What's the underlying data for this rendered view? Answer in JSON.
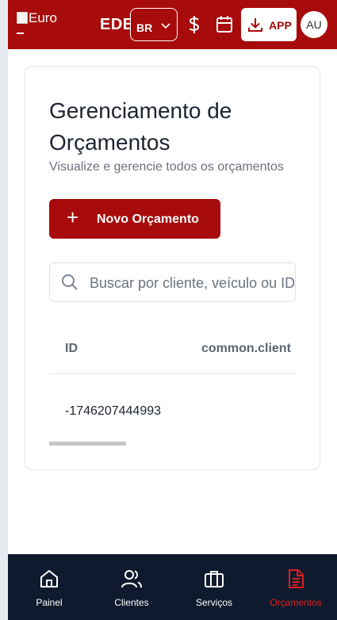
{
  "header": {
    "logo_alt": "Euro",
    "brand": "EDE",
    "language": "BR",
    "app_label": "APP",
    "avatar_initials": "AU",
    "background_color": "#a80b0b"
  },
  "icons": {
    "currency": "dollar-icon",
    "calendar": "calendar-icon",
    "download": "download-icon",
    "search": "search-icon"
  },
  "page": {
    "title": "Gerenciamento de Orçamentos",
    "subtitle": "Visualize e gerencie todos os orçamentos",
    "new_button": "Novo Orçamento",
    "new_button_icon": "+",
    "search_placeholder": "Buscar por cliente, veículo ou ID..."
  },
  "table": {
    "columns": [
      "ID",
      "common.client"
    ],
    "rows": [
      {
        "id": "-1746207444993",
        "client": ""
      }
    ]
  },
  "bottom_nav": {
    "items": [
      {
        "label": "Painel",
        "icon": "home-icon",
        "active": false
      },
      {
        "label": "Clientes",
        "icon": "users-icon",
        "active": false
      },
      {
        "label": "Serviços",
        "icon": "briefcase-icon",
        "active": false
      },
      {
        "label": "Orçamentos",
        "icon": "document-icon",
        "active": true
      }
    ],
    "active_color": "#e11d1d"
  }
}
